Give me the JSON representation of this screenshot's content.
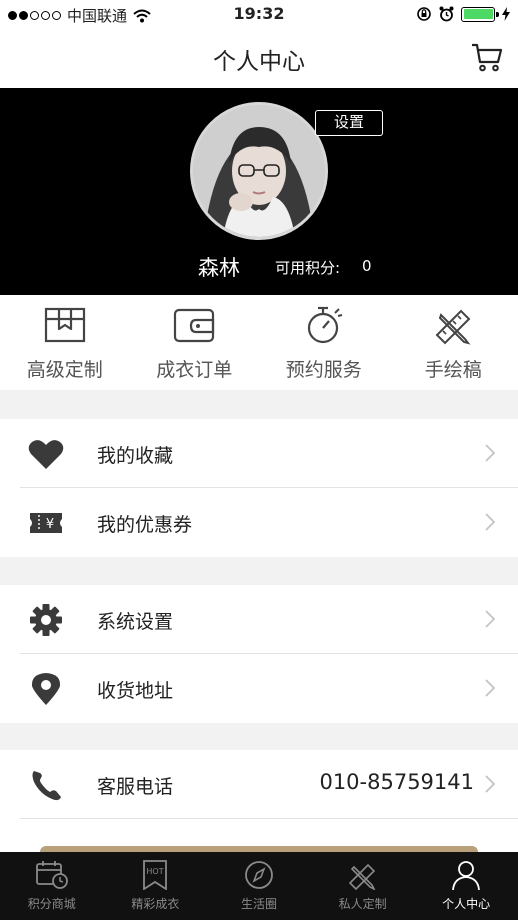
{
  "status_bar": {
    "carrier": "中国联通",
    "time": "19:32"
  },
  "nav": {
    "title": "个人中心"
  },
  "profile": {
    "settings_label": "设置",
    "username": "森林",
    "points_label": "可用积分:",
    "points_value": "0"
  },
  "quick_actions": [
    {
      "label": "高级定制",
      "icon": "box-icon"
    },
    {
      "label": "成衣订单",
      "icon": "wallet-icon"
    },
    {
      "label": "预约服务",
      "icon": "stopwatch-icon"
    },
    {
      "label": "手绘稿",
      "icon": "pencil-ruler-icon"
    }
  ],
  "menu": {
    "favorites": "我的收藏",
    "coupons": "我的优惠券",
    "coupon_symbol": "¥",
    "system_settings": "系统设置",
    "address": "收货地址",
    "service_phone_label": "客服电话",
    "service_phone_value": "010-85759141"
  },
  "tabs": [
    {
      "label": "积分商城",
      "icon": "calendar-clock-icon",
      "active": false
    },
    {
      "label": "精彩成衣",
      "icon": "hot-bookmark-icon",
      "badge": "HOT",
      "active": false
    },
    {
      "label": "生活圈",
      "icon": "compass-icon",
      "active": false
    },
    {
      "label": "私人定制",
      "icon": "pencil-ruler-icon",
      "active": false
    },
    {
      "label": "个人中心",
      "icon": "person-icon",
      "active": true
    }
  ],
  "colors": {
    "header_bg": "#000000",
    "battery": "#4cd964",
    "tabbar_bg": "#111111",
    "accent_peek": "#b8a07a"
  }
}
